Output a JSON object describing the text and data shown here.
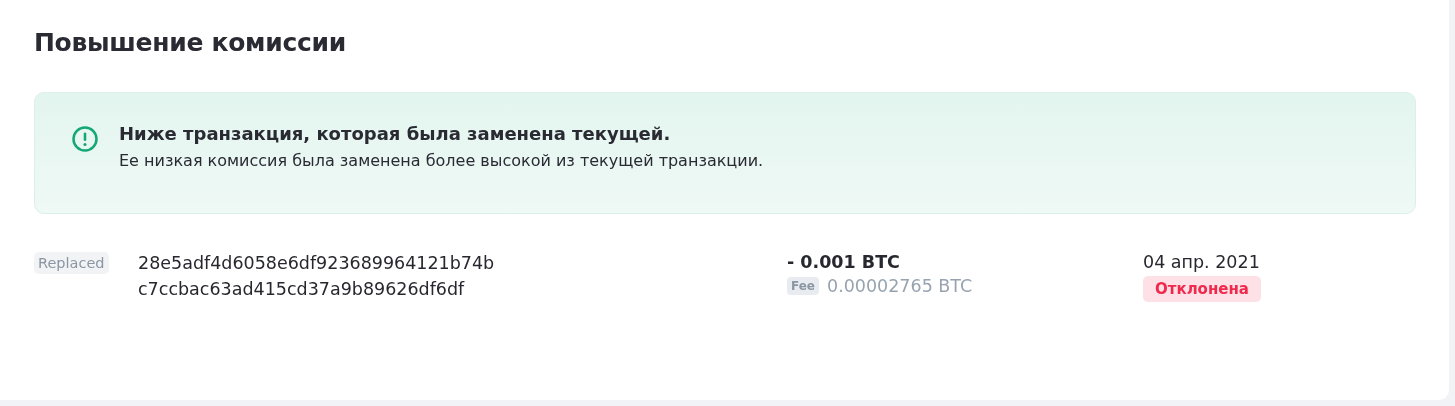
{
  "title": "Повышение комиссии",
  "notice": {
    "kind": "info",
    "heading": "Ниже транзакция, которая была заменена текущей.",
    "text": "Ее низкая комиссия была заменена более высокой из текущей транзакции."
  },
  "transactions": [
    {
      "tag": "Replaced",
      "hash_lines": [
        "28e5adf4d6058e6df923689964121b74b",
        "c7ccbac63ad415cd37a9b89626df6df"
      ],
      "amount": "- 0.001 BTC",
      "fee_label": "Fee",
      "fee": "0.00002765 BTC",
      "date": "04 апр. 2021",
      "status": {
        "label": "Отклонена",
        "kind": "rejected"
      }
    }
  ]
}
